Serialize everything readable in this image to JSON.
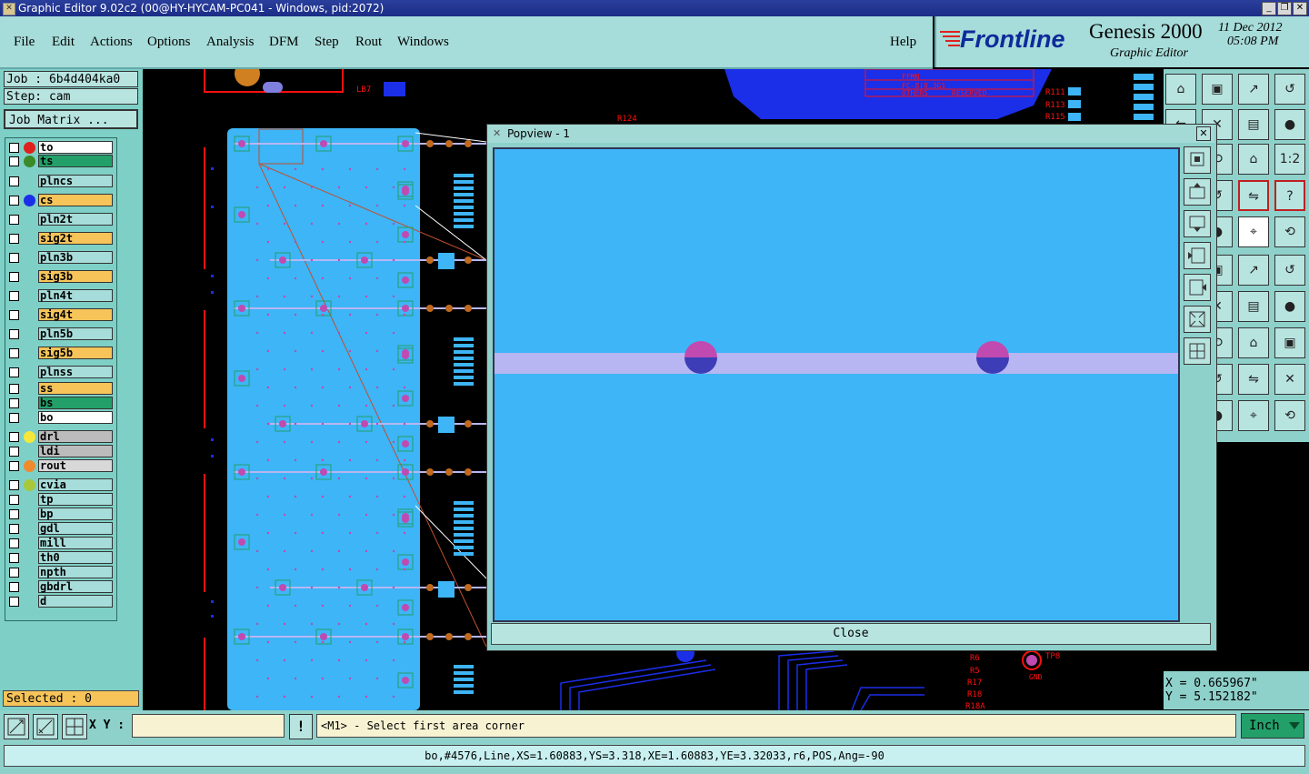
{
  "window": {
    "title": "Graphic Editor 9.02c2 (00@HY-HYCAM-PC041 - Windows, pid:2072)",
    "minimize_label": "_",
    "maximize_label": "❐",
    "close_label": "✕"
  },
  "menu": {
    "file": "File",
    "edit": "Edit",
    "actions": "Actions",
    "options": "Options",
    "analysis": "Analysis",
    "dfm": "DFM",
    "step": "Step",
    "rout": "Rout",
    "windows": "Windows",
    "help": "Help"
  },
  "brand": {
    "logo": "Frontline",
    "product": "Genesis 2000",
    "subtitle": "Graphic Editor",
    "date": "11 Dec 2012",
    "time": "05:08 PM"
  },
  "job": {
    "job_label": "Job  : 6b4d404ka0",
    "step_label": "Step: cam",
    "matrix_button": "Job Matrix ..."
  },
  "layers": [
    {
      "name": "to",
      "bg": "#ffffff",
      "dot": "#e0201c"
    },
    {
      "name": "ts",
      "bg": "#23a06a",
      "dot": "#3a8a28"
    },
    {
      "name": "plncs",
      "bg": "#a6dcd9",
      "dot": ""
    },
    {
      "name": "cs",
      "bg": "#f7c45a",
      "dot": "#1b2ee8"
    },
    {
      "name": "pln2t",
      "bg": "#a6dcd9",
      "dot": ""
    },
    {
      "name": "sig2t",
      "bg": "#f7c45a",
      "dot": ""
    },
    {
      "name": "pln3b",
      "bg": "#a6dcd9",
      "dot": ""
    },
    {
      "name": "sig3b",
      "bg": "#f7c45a",
      "dot": ""
    },
    {
      "name": "pln4t",
      "bg": "#a6dcd9",
      "dot": ""
    },
    {
      "name": "sig4t",
      "bg": "#f7c45a",
      "dot": ""
    },
    {
      "name": "pln5b",
      "bg": "#a6dcd9",
      "dot": ""
    },
    {
      "name": "sig5b",
      "bg": "#f7c45a",
      "dot": ""
    },
    {
      "name": "plnss",
      "bg": "#a6dcd9",
      "dot": ""
    },
    {
      "name": "ss",
      "bg": "#f7c45a",
      "dot": ""
    },
    {
      "name": "bs",
      "bg": "#23a06a",
      "dot": ""
    },
    {
      "name": "bo",
      "bg": "#ffffff",
      "dot": ""
    },
    {
      "name": "drl",
      "bg": "#bcbcbc",
      "dot": "#f5e83a"
    },
    {
      "name": "ldi",
      "bg": "#bcbcbc",
      "dot": ""
    },
    {
      "name": "rout",
      "bg": "#d8d8d8",
      "dot": "#f08a2c"
    },
    {
      "name": "cvia",
      "bg": "#a6dcd9",
      "dot": "#a8c83a"
    },
    {
      "name": "tp",
      "bg": "#a6dcd9",
      "dot": ""
    },
    {
      "name": "bp",
      "bg": "#a6dcd9",
      "dot": ""
    },
    {
      "name": "gdl",
      "bg": "#a6dcd9",
      "dot": ""
    },
    {
      "name": "mill",
      "bg": "#a6dcd9",
      "dot": ""
    },
    {
      "name": "th0",
      "bg": "#a6dcd9",
      "dot": ""
    },
    {
      "name": "npth",
      "bg": "#a6dcd9",
      "dot": ""
    },
    {
      "name": "gbdrl",
      "bg": "#a6dcd9",
      "dot": ""
    },
    {
      "name": "d",
      "bg": "#a6dcd9",
      "dot": ""
    }
  ],
  "selected": "Selected : 0",
  "popview": {
    "title": "Popview - 1",
    "close": "Close",
    "close_icon": "✕"
  },
  "pcb_labels": {
    "lb7": "LB7",
    "r124": "R124",
    "r111": "R111",
    "r113": "R113",
    "r115": "R115",
    "ffmn": "FFMN",
    "others": "OTHERS",
    "reserved": "RESERVED",
    "fc": "FC-8(8.3G1",
    "tp8": "TP8",
    "gnd": "GND",
    "r6": "R6",
    "r5": "R5",
    "r17": "R17",
    "r18": "R18",
    "r18a": "R18A"
  },
  "tool_labels": {
    "one_to_two": "1:2",
    "question": "?"
  },
  "coords": {
    "x": "X  =  0.665967\"",
    "y": "Y  =  5.152182\""
  },
  "bottom": {
    "xy_label": "X Y :",
    "xy_value": "",
    "alert": "!",
    "prompt": "<M1> - Select first area corner",
    "units": "Inch",
    "status": "bo,#4576,Line,XS=1.60883,YS=3.318,XE=1.60883,YE=3.32033,r6,POS,Ang=-90"
  },
  "colors": {
    "panel": "#8ed1cb",
    "board": "#3db5f6",
    "trace": "#b7b6f2",
    "pad_top": "#c04ab0",
    "pad_bottom": "#3d3db8",
    "copper_red": "#ff1010",
    "plane_blue": "#1b2ee8"
  }
}
